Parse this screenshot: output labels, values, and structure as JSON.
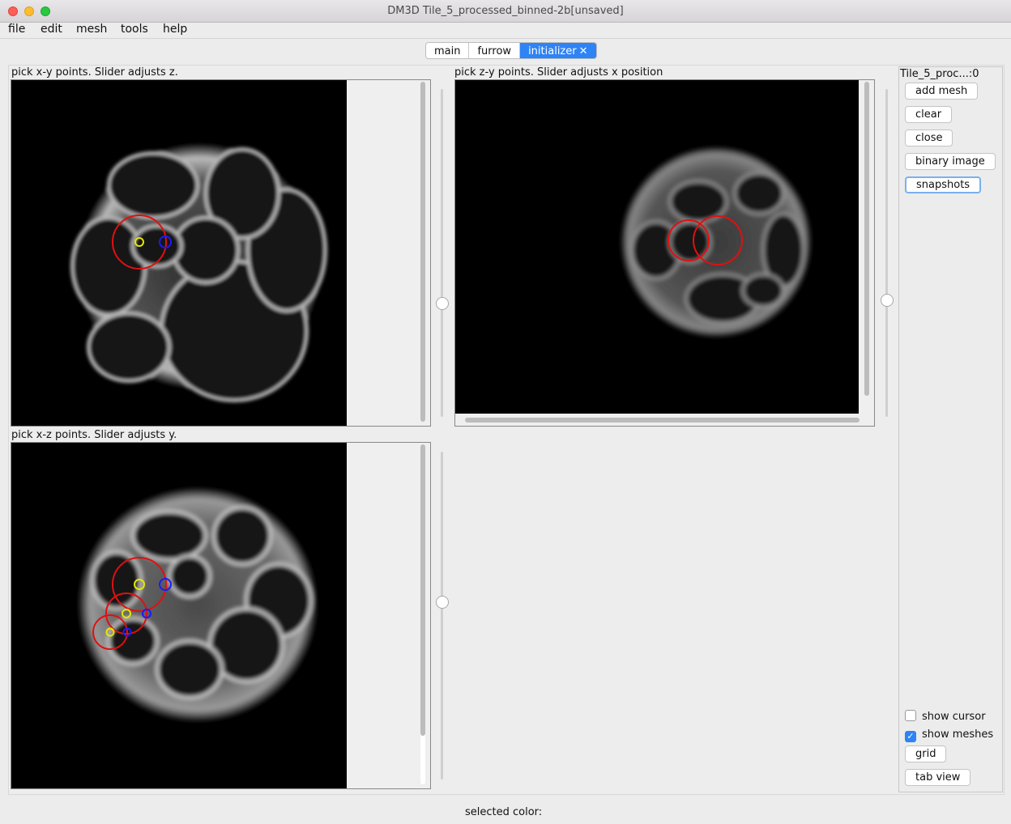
{
  "window": {
    "title": "DM3D Tile_5_processed_binned-2b[unsaved]"
  },
  "menubar": {
    "items": [
      "file",
      "edit",
      "mesh",
      "tools",
      "help"
    ]
  },
  "tabs": {
    "items": [
      "main",
      "furrow",
      "initializer"
    ],
    "active": "initializer",
    "close_glyph": "✕"
  },
  "panels": {
    "xy_label": "pick x-y points. Slider adjusts z.",
    "zy_label": "pick z-y points. Slider adjusts x position",
    "xz_label": "pick x-z points. Slider adjusts y."
  },
  "sidebar": {
    "title": "Tile_5_proc...:0",
    "buttons": {
      "add_mesh": "add mesh",
      "clear": "clear",
      "close": "close",
      "binary_image": "binary image",
      "snapshots": "snapshots",
      "grid": "grid",
      "tab_view": "tab view"
    },
    "checkboxes": {
      "show_cursor": {
        "label": "show cursor",
        "checked": false
      },
      "show_meshes": {
        "label": "show meshes",
        "checked": true
      }
    }
  },
  "status": {
    "selected_color": "selected color:"
  },
  "colors": {
    "accent": "#2e83f5",
    "mesh_circle": "#e01010",
    "point_yellow": "#e6e600",
    "point_blue": "#1a1aff"
  }
}
